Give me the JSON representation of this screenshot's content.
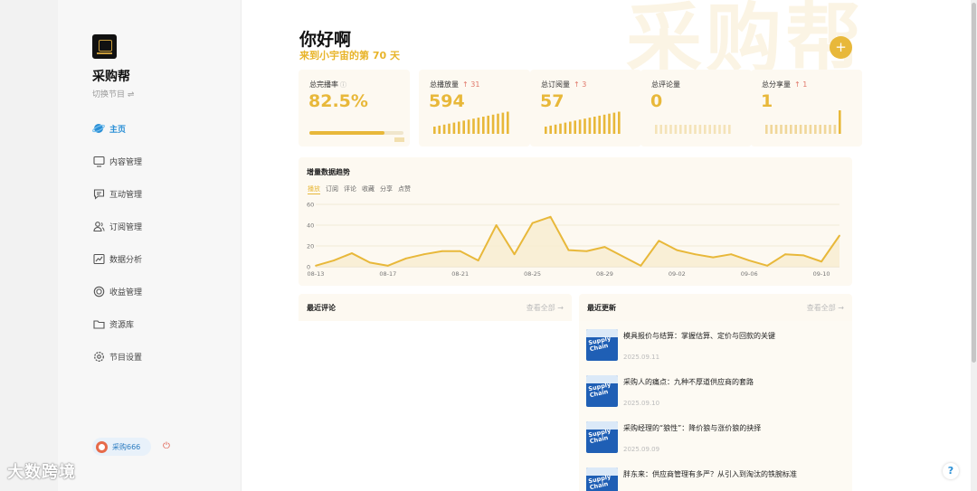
{
  "brand": {
    "name": "采购帮",
    "switch_label": "切换节目 ⇌"
  },
  "nav": [
    {
      "label": "主页",
      "icon": "planet-icon",
      "active": true
    },
    {
      "label": "内容管理",
      "icon": "monitor-icon"
    },
    {
      "label": "互动管理",
      "icon": "chat-icon"
    },
    {
      "label": "订阅管理",
      "icon": "users-icon"
    },
    {
      "label": "数据分析",
      "icon": "chart-icon"
    },
    {
      "label": "收益管理",
      "icon": "coin-icon"
    },
    {
      "label": "资源库",
      "icon": "folder-icon"
    },
    {
      "label": "节目设置",
      "icon": "gear-icon"
    }
  ],
  "user": {
    "name": "采购666"
  },
  "watermark": "大数跨境",
  "header": {
    "greeting": "你好啊",
    "subgreeting": "来到小宇宙的第 70 天",
    "bg_text": "采购帮",
    "add_label": "+"
  },
  "stats": [
    {
      "label": "总完播率",
      "value": "82.5%",
      "info": "ⓘ",
      "progress": 0.8
    },
    {
      "label": "总播放量",
      "value": "594",
      "delta": "↑ 31"
    },
    {
      "label": "总订阅量",
      "value": "57",
      "delta": "↑ 3"
    },
    {
      "label": "总评论量",
      "value": "0"
    },
    {
      "label": "总分享量",
      "value": "1",
      "delta": "↑ 1"
    }
  ],
  "trend": {
    "title": "增量数据趋势",
    "tabs": [
      "播放",
      "订阅",
      "评论",
      "收藏",
      "分享",
      "点赞"
    ],
    "active_tab": 0
  },
  "chart_data": {
    "type": "area",
    "series": [
      {
        "values": [
          1,
          6,
          13,
          4,
          1,
          8,
          12,
          15,
          15,
          6,
          40,
          12,
          42,
          48,
          16,
          15,
          19,
          10,
          1,
          25,
          16,
          12,
          9,
          12,
          6,
          1,
          12,
          11,
          5,
          30
        ]
      }
    ],
    "x_tick_labels": [
      "08-13",
      "08-17",
      "08-21",
      "08-25",
      "08-29",
      "09-02",
      "09-06",
      "09-10"
    ],
    "y_tick_labels": [
      "0",
      "20",
      "40",
      "60"
    ],
    "ylim": [
      0,
      60
    ],
    "grid": true,
    "color": "#e8b83a"
  },
  "comments": {
    "title": "最近评论",
    "more": "查看全部 →"
  },
  "updates": {
    "title": "最近更新",
    "more": "查看全部 →",
    "thumb_text": "Supply Chain",
    "items": [
      {
        "title": "模具报价与结算：掌握估算、定价与回款的关键",
        "date": "2025.09.11"
      },
      {
        "title": "采购人的痛点：九种不厚道供应商的套路",
        "date": "2025.09.10"
      },
      {
        "title": "采购经理的“狼性”：降价狼与涨价狼的抉择",
        "date": "2025.09.09"
      },
      {
        "title": "胖东来：供应商管理有多严？从引入到淘汰的铁腕标准",
        "date": ""
      }
    ]
  },
  "help_label": "?"
}
